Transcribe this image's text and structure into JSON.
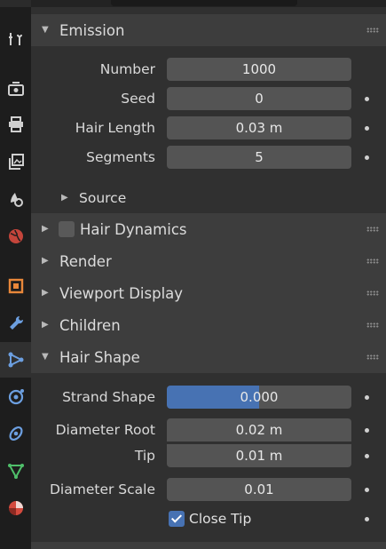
{
  "emission": {
    "title": "Emission",
    "fields": [
      {
        "label": "Number",
        "value": "1000"
      },
      {
        "label": "Seed",
        "value": "0"
      },
      {
        "label": "Hair Length",
        "value": "0.03 m"
      },
      {
        "label": "Segments",
        "value": "5"
      }
    ],
    "source_label": "Source"
  },
  "collapsed_panels": {
    "hair_dynamics": "Hair Dynamics",
    "render": "Render",
    "viewport_display": "Viewport Display",
    "children": "Children"
  },
  "hair_shape": {
    "title": "Hair Shape",
    "strand_shape": {
      "label": "Strand Shape",
      "value": "0.000",
      "fill": 0.5
    },
    "diameter_root": {
      "label": "Diameter Root",
      "value": "0.02 m"
    },
    "tip": {
      "label": "Tip",
      "value": "0.01 m"
    },
    "diameter_scale": {
      "label": "Diameter Scale",
      "value": "0.01"
    },
    "close_tip": {
      "label": "Close Tip",
      "checked": true
    }
  },
  "tabs": [
    "tool-icon",
    "render-icon",
    "output-icon",
    "view-layer-icon",
    "scene-icon",
    "world-icon",
    "object-icon",
    "modifier-icon",
    "particles-icon",
    "physics-icon",
    "constraints-icon",
    "object-data-icon",
    "material-icon"
  ],
  "colors": {
    "accent": "#4772b3",
    "field": "#545454",
    "header": "#3d3d3d",
    "panel": "#303030"
  }
}
